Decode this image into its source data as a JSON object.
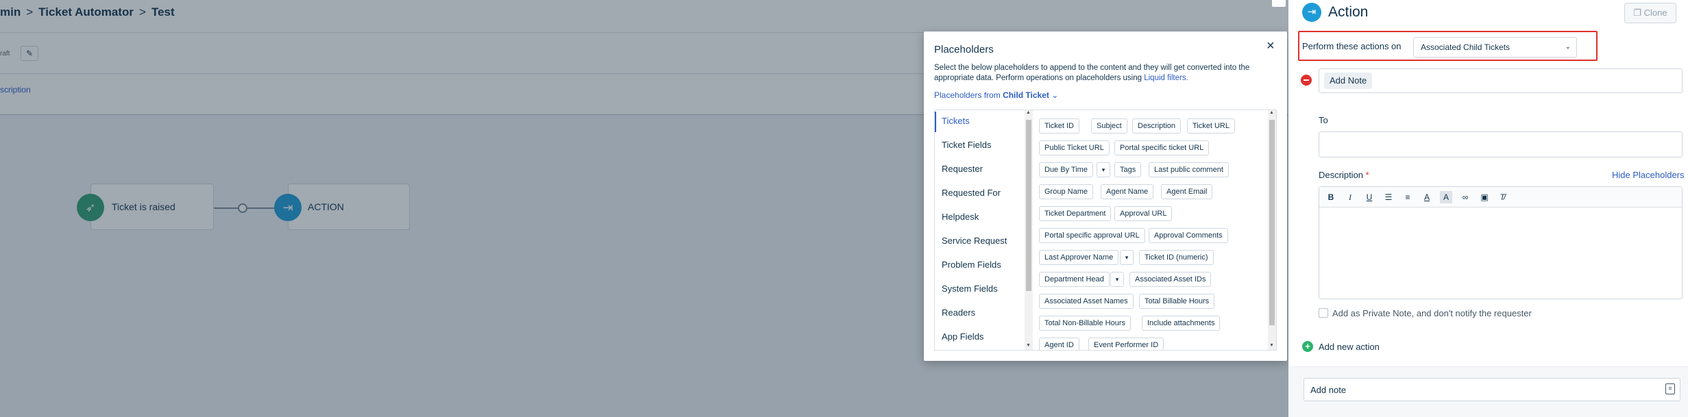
{
  "breadcrumb": {
    "part1": "min",
    "part2": "Ticket Automator",
    "part3": "Test",
    "separator": ">"
  },
  "subbar": {
    "draft_text": "raft"
  },
  "descbar": {
    "link": "scription"
  },
  "workflow": {
    "node1_label": "Ticket is raised",
    "node2_label": "ACTION"
  },
  "placeholders": {
    "title": "Placeholders",
    "close": "×",
    "description": "Select the below placeholders to append to the content and they will get converted into the appropriate data. Perform operations on placeholders using ",
    "description_link": "Liquid filters.",
    "from_label": "Placeholders from",
    "from_value": "Child Ticket",
    "from_chevron": "⌄",
    "categories": [
      "Tickets",
      "Ticket Fields",
      "Requester",
      "Requested For",
      "Helpdesk",
      "Service Request",
      "Problem Fields",
      "System Fields",
      "Readers",
      "App Fields"
    ],
    "chips": [
      "Ticket ID",
      "Subject",
      "Description",
      "Ticket URL",
      "Public Ticket URL",
      "Portal specific ticket URL",
      "Due By Time",
      "Tags",
      "Last public comment",
      "Group Name",
      "Agent Name",
      "Agent Email",
      "Ticket Department",
      "Approval URL",
      "Portal specific approval URL",
      "Approval Comments",
      "Last Approver Name",
      "Ticket ID (numeric)",
      "Department Head",
      "Associated Asset IDs",
      "Associated Asset Names",
      "Total Billable Hours",
      "Total Non-Billable Hours",
      "Include attachments",
      "Agent ID",
      "Event Performer ID"
    ]
  },
  "action_panel": {
    "title": "Action",
    "clone_label": "Clone",
    "perform_label": "Perform these actions on",
    "perform_value": "Associated Child Tickets",
    "note_tag": "Add Note",
    "to_label": "To",
    "description_label": "Description",
    "required_mark": "*",
    "hide_placeholders": "Hide Placeholders",
    "private_note_label": "Add as Private Note, and don't notify the requester",
    "add_new_action": "Add new action",
    "footer_note": "Add note"
  },
  "colors": {
    "accent": "#2c5cc5",
    "danger": "#e0302d",
    "success": "#2db46b",
    "action": "#1e9bd7",
    "trigger": "#2f9e72"
  }
}
